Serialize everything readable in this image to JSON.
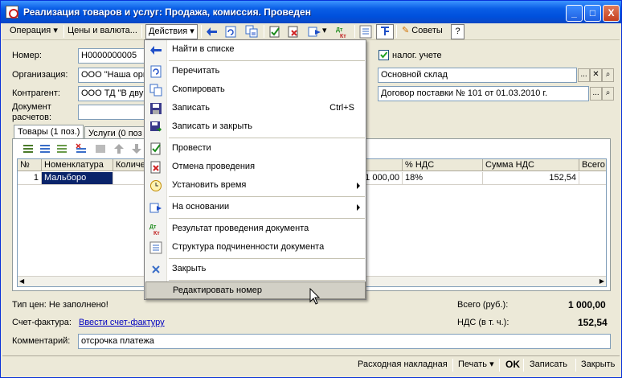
{
  "window": {
    "title": "Реализация товаров и услуг: Продажа, комиссия. Проведен",
    "controls": [
      "_",
      "□",
      "X"
    ]
  },
  "toolbar": {
    "operation": "Операция",
    "prices": "Цены и валюта...",
    "actions": "Действия",
    "advice": "Советы",
    "help": "?"
  },
  "form": {
    "number_label": "Номер:",
    "number_value": "Н0000000005",
    "org_label": "Организация:",
    "org_value": "ООО \"Наша орг",
    "contractor_label": "Контрагент:",
    "contractor_value": "ООО ТД \"В дву",
    "doc_label_1": "Документ",
    "doc_label_2": "расчетов:",
    "tax_checkbox_label": "налог. учете",
    "warehouse_value": "Основной склад",
    "contract_value": "Договор поставки № 101 от 01.03.2010 г."
  },
  "tabs": [
    {
      "label": "Товары (1 поз.)"
    },
    {
      "label": "Услуги (0 поз"
    }
  ],
  "grid": {
    "headers": [
      "№",
      "Номенклатура",
      "Количе",
      "",
      "% НДС",
      "Сумма НДС",
      "Всего"
    ],
    "rows": [
      {
        "n": "1",
        "name": "Мальборо",
        "qty": "",
        "sum": "1 000,00",
        "vat": "18%",
        "vat_sum": "152,54",
        "total": ""
      }
    ]
  },
  "menu": {
    "items": [
      {
        "label": "Найти в списке",
        "shortcut": "",
        "submenu": false,
        "icon": "find-in-list-icon"
      },
      {
        "label": "Перечитать",
        "shortcut": "",
        "submenu": false,
        "icon": "reread-icon"
      },
      {
        "label": "Скопировать",
        "shortcut": "",
        "submenu": false,
        "icon": "copy-icon"
      },
      {
        "label": "Записать",
        "shortcut": "Ctrl+S",
        "submenu": false,
        "icon": "save-icon"
      },
      {
        "label": "Записать и закрыть",
        "shortcut": "",
        "submenu": false,
        "icon": "save-close-icon"
      },
      {
        "label": "Провести",
        "shortcut": "",
        "submenu": false,
        "icon": "post-icon"
      },
      {
        "label": "Отмена проведения",
        "shortcut": "",
        "submenu": false,
        "icon": "unpost-icon"
      },
      {
        "label": "Установить время",
        "shortcut": "",
        "submenu": true,
        "icon": "clock-icon"
      },
      {
        "label": "На основании",
        "shortcut": "",
        "submenu": true,
        "icon": "based-on-icon"
      },
      {
        "label": "Результат проведения документа",
        "shortcut": "",
        "submenu": false,
        "icon": "dt-kt-icon"
      },
      {
        "label": "Структура подчиненности документа",
        "shortcut": "",
        "submenu": false,
        "icon": "structure-icon"
      },
      {
        "label": "Закрыть",
        "shortcut": "",
        "submenu": false,
        "icon": "close-x-icon"
      },
      {
        "label": "Редактировать номер",
        "shortcut": "",
        "submenu": false,
        "icon": ""
      }
    ]
  },
  "footer": {
    "price_type": "Тип цен: Не заполнено!",
    "invoice_label": "Счет-фактура:",
    "invoice_link": "Ввести счет-фактуру",
    "total_label": "Всего (руб.):",
    "total_value": "1 000,00",
    "vat_label": "НДС (в т. ч.):",
    "vat_value": "152,54",
    "comment_label": "Комментарий:",
    "comment_value": "отсрочка платежа"
  },
  "bottom": {
    "waybill": "Расходная накладная",
    "print": "Печать",
    "ok": "OK",
    "save": "Записать",
    "close": "Закрыть"
  },
  "colors": {
    "titlebar": "#0050dc",
    "selection": "#0a246a",
    "menu_highlight": "#d2d0c6",
    "window_bg": "#ece9d8"
  }
}
